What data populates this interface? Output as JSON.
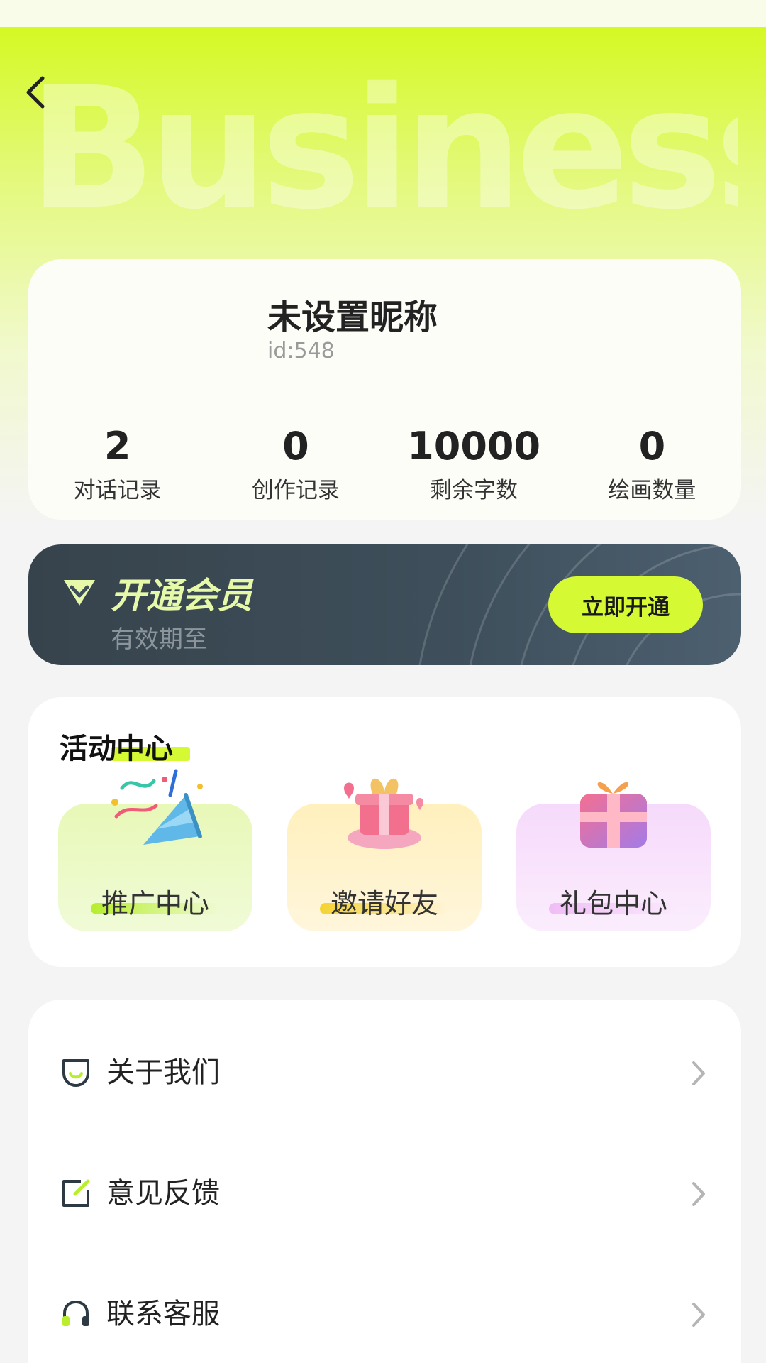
{
  "header": {
    "brand_watermark": "BusinessAI",
    "back_icon": "chevron-left-icon"
  },
  "profile": {
    "nickname": "未设置昵称",
    "user_id": "id:548",
    "stats": [
      {
        "value": "2",
        "label": "对话记录"
      },
      {
        "value": "0",
        "label": "创作记录"
      },
      {
        "value": "10000",
        "label": "剩余字数"
      },
      {
        "value": "0",
        "label": "绘画数量"
      }
    ]
  },
  "vip": {
    "icon": "diamond-icon",
    "title": "开通会员",
    "expire_label": "有效期至",
    "button_label": "立即开通",
    "accent_color": "#d5f933",
    "background_color": "#3e4f5b"
  },
  "activity": {
    "title": "活动中心",
    "tiles": [
      {
        "label": "推广中心",
        "icon": "party-popper-icon"
      },
      {
        "label": "邀请好友",
        "icon": "gift-box-hand-icon"
      },
      {
        "label": "礼包中心",
        "icon": "gift-box-icon"
      }
    ]
  },
  "menu": {
    "items": [
      {
        "label": "关于我们",
        "icon": "smile-shield-icon"
      },
      {
        "label": "意见反馈",
        "icon": "edit-note-icon"
      },
      {
        "label": "联系客服",
        "icon": "headset-icon"
      }
    ],
    "chevron_icon": "chevron-right-icon"
  },
  "colors": {
    "brand_lime": "#d4f923",
    "page_background": "#f4f4f4"
  }
}
